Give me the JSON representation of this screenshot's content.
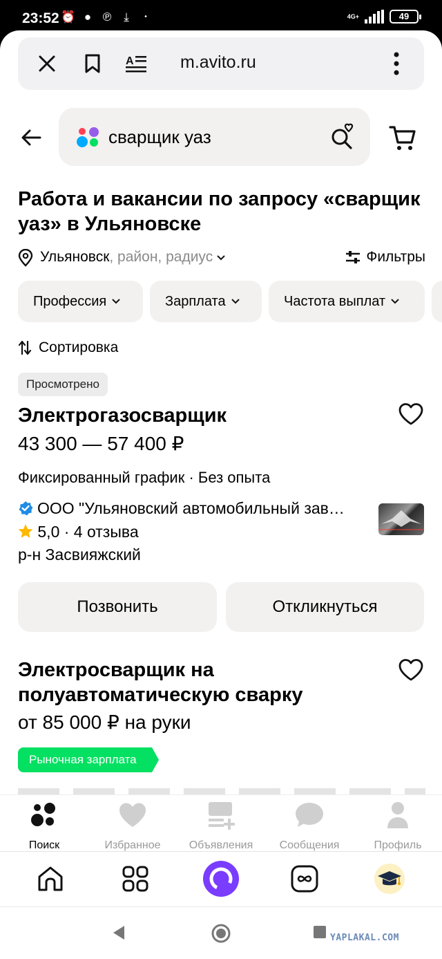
{
  "status_bar": {
    "time": "23:52",
    "network": "4G+",
    "battery": "49"
  },
  "browser": {
    "url": "m.avito.ru"
  },
  "search": {
    "query": "сварщик уаз"
  },
  "page": {
    "title": "Работа и вакансии по запросу «сварщик уаз» в Ульяновске",
    "location_city": "Ульяновск",
    "location_rest": ", район, радиус",
    "filters_label": "Фильтры",
    "chips": [
      "Профессия",
      "Зарплата",
      "Частота выплат"
    ],
    "sort_label": "Сортировка"
  },
  "listings": [
    {
      "badge": "Просмотрено",
      "title": "Электрогазосварщик",
      "salary": "43 300 — 57 400 ₽",
      "meta": "Фиксированный график · Без опыта",
      "company": "ООО \"Ульяновский автомобильный зав…",
      "rating": "5,0 · 4 отзыва",
      "district": "р-н Засвияжский",
      "call_label": "Позвонить",
      "respond_label": "Откликнуться"
    },
    {
      "title": "Электросварщик на полуавтоматическую сварку",
      "salary": "от 85 000 ₽ на руки",
      "badge": "Рыночная зарплата"
    }
  ],
  "app_nav": [
    {
      "label": "Поиск",
      "icon": "search-dots-icon",
      "active": true
    },
    {
      "label": "Избранное",
      "icon": "heart-icon",
      "active": false
    },
    {
      "label": "Объявления",
      "icon": "ads-icon",
      "active": false
    },
    {
      "label": "Сообщения",
      "icon": "chat-icon",
      "active": false
    },
    {
      "label": "Профиль",
      "icon": "profile-icon",
      "active": false
    }
  ],
  "colors": {
    "accent_purple": "#7a3cff",
    "market_green": "#04e061",
    "verified_blue": "#1f8ce6",
    "star": "#ffb800"
  },
  "watermark": "YAPLAKAL.COM"
}
